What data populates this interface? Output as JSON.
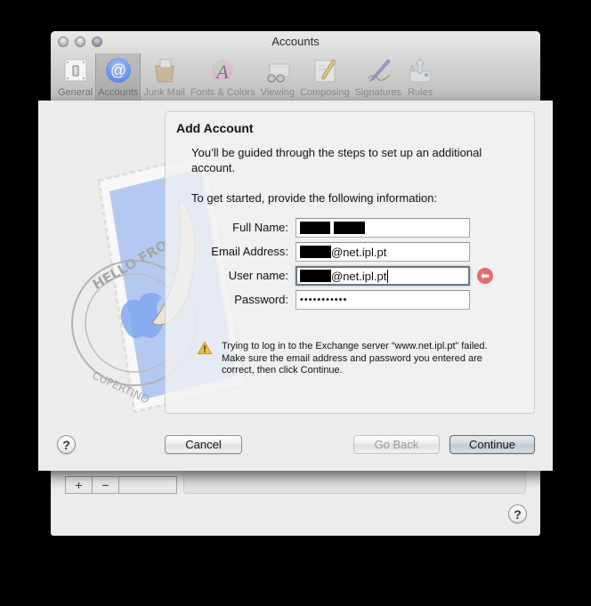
{
  "window": {
    "title": "Accounts",
    "traffic_lights": [
      "close",
      "minimize",
      "zoom"
    ]
  },
  "toolbar": {
    "items": [
      {
        "label": "General",
        "icon": "switch-icon",
        "active": false
      },
      {
        "label": "Accounts",
        "icon": "at-sign-icon",
        "active": true
      },
      {
        "label": "Junk Mail",
        "icon": "junk-bag-icon",
        "active": false
      },
      {
        "label": "Fonts & Colors",
        "icon": "font-color-icon",
        "active": false
      },
      {
        "label": "Viewing",
        "icon": "glasses-envelope-icon",
        "active": false
      },
      {
        "label": "Composing",
        "icon": "pencil-paper-icon",
        "active": false
      },
      {
        "label": "Signatures",
        "icon": "pen-signature-icon",
        "active": false
      },
      {
        "label": "Rules",
        "icon": "arrows-rules-icon",
        "active": false
      }
    ]
  },
  "account_list": {
    "add_label": "+",
    "remove_label": "−"
  },
  "sheet": {
    "heading": "Add Account",
    "intro": "You’ll be guided through the steps to set up an additional account.",
    "prompt": "To get started, provide the following information:",
    "fields": {
      "full_name": {
        "label": "Full Name:",
        "value": "[redacted]"
      },
      "email": {
        "label": "Email Address:",
        "value_suffix": "@net.ipl.pt"
      },
      "username": {
        "label": "User name:",
        "value_suffix": "@net.ipl.pt",
        "focused": true,
        "error": true
      },
      "password": {
        "label": "Password:",
        "value": "•••••••••••"
      }
    },
    "warning": "Trying to log in to the Exchange server “www.net.ipl.pt” failed. Make sure the email address and password you entered are correct, then click Continue.",
    "buttons": {
      "cancel": "Cancel",
      "go_back": "Go Back",
      "continue": "Continue"
    },
    "help_label": "?"
  },
  "colors": {
    "error_badge": "#e26d6d",
    "accounts_icon": "#6f9cf0",
    "warning_icon": "#f2c230"
  }
}
